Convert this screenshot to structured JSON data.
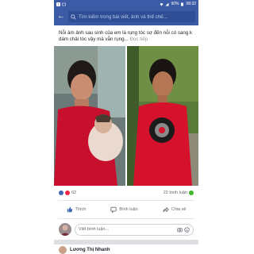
{
  "status_bar": {
    "battery": "90%",
    "time": "08:32"
  },
  "search": {
    "placeholder": "Tìm kiếm trong bài viết, ảnh và thể chế..."
  },
  "post": {
    "text": "Nỗi ám ảnh sau sinh của em là rụng tóc sợ đến nỗi có sang k dám chải tóc vậy mà vẫn rụng...",
    "more_label": "Đọc tiếp"
  },
  "reactions": {
    "count": "62",
    "comments": "22 bình luận"
  },
  "actions": {
    "like": "Thích",
    "comment": "Bình luận",
    "share": "Chia sẻ"
  },
  "comment_box": {
    "placeholder": "Viết bình luận..."
  },
  "next_post": {
    "author": "Lương Thị Nhanh"
  },
  "colors": {
    "facebook_blue": "#3b5ba6",
    "like_blue": "#4267b2",
    "heart_red": "#f0284a"
  }
}
